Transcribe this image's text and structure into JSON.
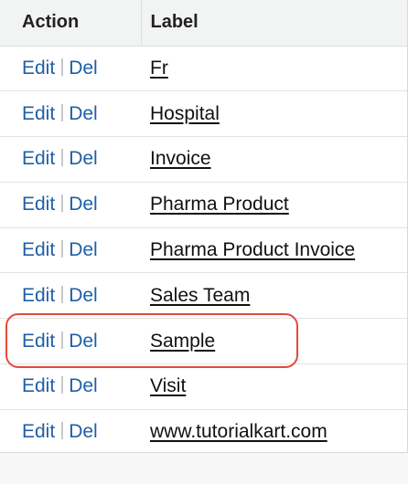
{
  "table": {
    "headers": {
      "action": "Action",
      "label": "Label"
    },
    "rows": [
      {
        "edit": "Edit",
        "del": "Del",
        "label": "Fr"
      },
      {
        "edit": "Edit",
        "del": "Del",
        "label": "Hospital"
      },
      {
        "edit": "Edit",
        "del": "Del",
        "label": "Invoice"
      },
      {
        "edit": "Edit",
        "del": "Del",
        "label": "Pharma Product"
      },
      {
        "edit": "Edit",
        "del": "Del",
        "label": "Pharma Product Invoice"
      },
      {
        "edit": "Edit",
        "del": "Del",
        "label": "Sales Team"
      },
      {
        "edit": "Edit",
        "del": "Del",
        "label": "Sample"
      },
      {
        "edit": "Edit",
        "del": "Del",
        "label": "Visit"
      },
      {
        "edit": "Edit",
        "del": "Del",
        "label": "www.tutorialkart.com"
      }
    ]
  },
  "highlighted_row": "Sample",
  "colors": {
    "link": "#1f5fa8",
    "highlight": "#e5483c",
    "header_bg": "#f2f3f3"
  }
}
